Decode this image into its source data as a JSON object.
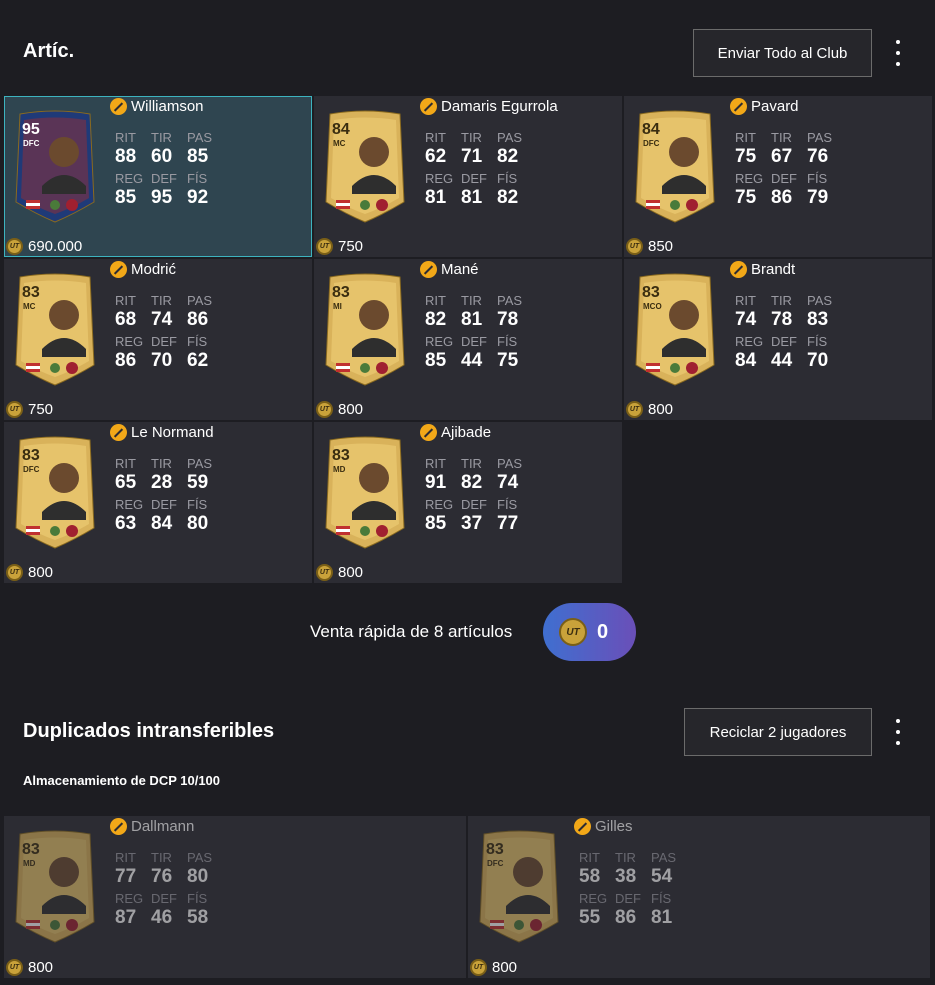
{
  "items_section": {
    "title": "Artíc.",
    "send_all_button": "Enviar Todo al Club",
    "players": [
      {
        "name": "Williamson",
        "rating": "95",
        "position": "DFC",
        "stats": {
          "rit": "88",
          "tir": "60",
          "pas": "85",
          "reg": "85",
          "def": "95",
          "fis": "92"
        },
        "price": "690.000",
        "selected": true,
        "special": true
      },
      {
        "name": "Damaris Egurrola",
        "rating": "84",
        "position": "MC",
        "stats": {
          "rit": "62",
          "tir": "71",
          "pas": "82",
          "reg": "81",
          "def": "81",
          "fis": "82"
        },
        "price": "750"
      },
      {
        "name": "Pavard",
        "rating": "84",
        "position": "DFC",
        "stats": {
          "rit": "75",
          "tir": "67",
          "pas": "76",
          "reg": "75",
          "def": "86",
          "fis": "79"
        },
        "price": "850"
      },
      {
        "name": "Modrić",
        "rating": "83",
        "position": "MC",
        "stats": {
          "rit": "68",
          "tir": "74",
          "pas": "86",
          "reg": "86",
          "def": "70",
          "fis": "62"
        },
        "price": "750"
      },
      {
        "name": "Mané",
        "rating": "83",
        "position": "MI",
        "stats": {
          "rit": "82",
          "tir": "81",
          "pas": "78",
          "reg": "85",
          "def": "44",
          "fis": "75"
        },
        "price": "800"
      },
      {
        "name": "Brandt",
        "rating": "83",
        "position": "MCO",
        "stats": {
          "rit": "74",
          "tir": "78",
          "pas": "83",
          "reg": "84",
          "def": "44",
          "fis": "70"
        },
        "price": "800"
      },
      {
        "name": "Le Normand",
        "rating": "83",
        "position": "DFC",
        "stats": {
          "rit": "65",
          "tir": "28",
          "pas": "59",
          "reg": "63",
          "def": "84",
          "fis": "80"
        },
        "price": "800"
      },
      {
        "name": "Ajibade",
        "rating": "83",
        "position": "MD",
        "stats": {
          "rit": "91",
          "tir": "82",
          "pas": "74",
          "reg": "85",
          "def": "37",
          "fis": "77"
        },
        "price": "800"
      }
    ]
  },
  "stat_labels": {
    "rit": "RIT",
    "tir": "TIR",
    "pas": "PAS",
    "reg": "REG",
    "def": "DEF",
    "fis": "FÍS"
  },
  "quick_sell": {
    "label": "Venta rápida de 8 artículos",
    "value": "0",
    "coin_text": "UT"
  },
  "duplicates_section": {
    "title": "Duplicados intransferibles",
    "recycle_button": "Reciclar 2 jugadores",
    "storage_label": "Almacenamiento de DCP 10/100",
    "players": [
      {
        "name": "Dallmann",
        "rating": "83",
        "position": "MD",
        "stats": {
          "rit": "77",
          "tir": "76",
          "pas": "80",
          "reg": "87",
          "def": "46",
          "fis": "58"
        },
        "price": "800"
      },
      {
        "name": "Gilles",
        "rating": "83",
        "position": "DFC",
        "stats": {
          "rit": "58",
          "tir": "38",
          "pas": "54",
          "reg": "55",
          "def": "86",
          "fis": "81"
        },
        "price": "800"
      }
    ]
  },
  "colors": {
    "background": "#1d1d22",
    "tile": "#2c2c33",
    "selected_tile": "#2f4550",
    "selected_border": "#3db3bf",
    "untradeable": "#f2a818",
    "gold_card": "#d9b25a"
  }
}
